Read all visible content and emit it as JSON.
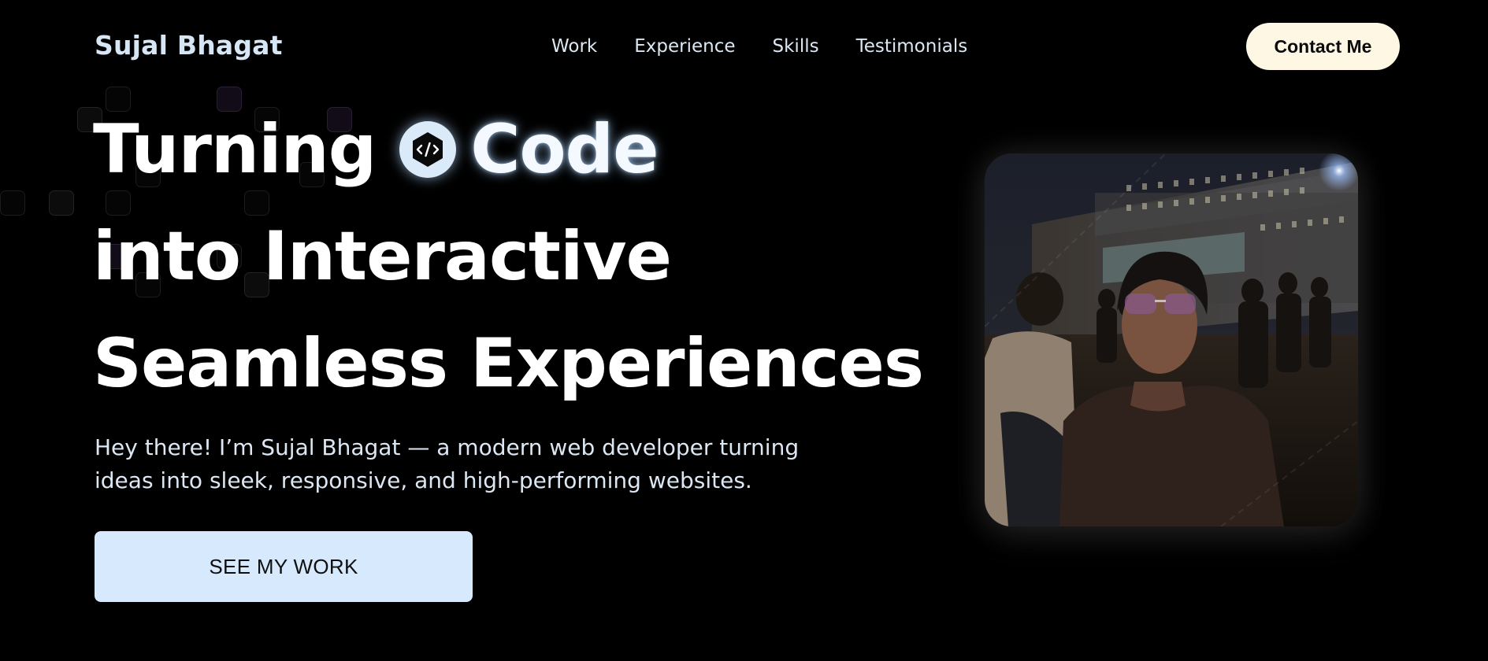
{
  "nav": {
    "brand": "Sujal Bhagat",
    "links": [
      "Work",
      "Experience",
      "Skills",
      "Testimonials"
    ],
    "contact_label": "Contact Me"
  },
  "hero": {
    "line1_word1": "Turning",
    "line1_word2": "Code",
    "line2": "into Interactive",
    "line3": "Seamless Experiences",
    "intro": "Hey there! I’m Sujal Bhagat — a modern web developer turning ideas into sleek, responsive, and high-performing websites.",
    "cta_label": "SEE MY WORK",
    "badge_icon": "code-brackets-icon",
    "portrait": "profile-photo"
  },
  "colors": {
    "background": "#000000",
    "brand_text": "#d6e6f5",
    "contact_button": "#fdf7e4",
    "cta_button": "#d7e9fc",
    "badge": "#dbeaf9"
  }
}
